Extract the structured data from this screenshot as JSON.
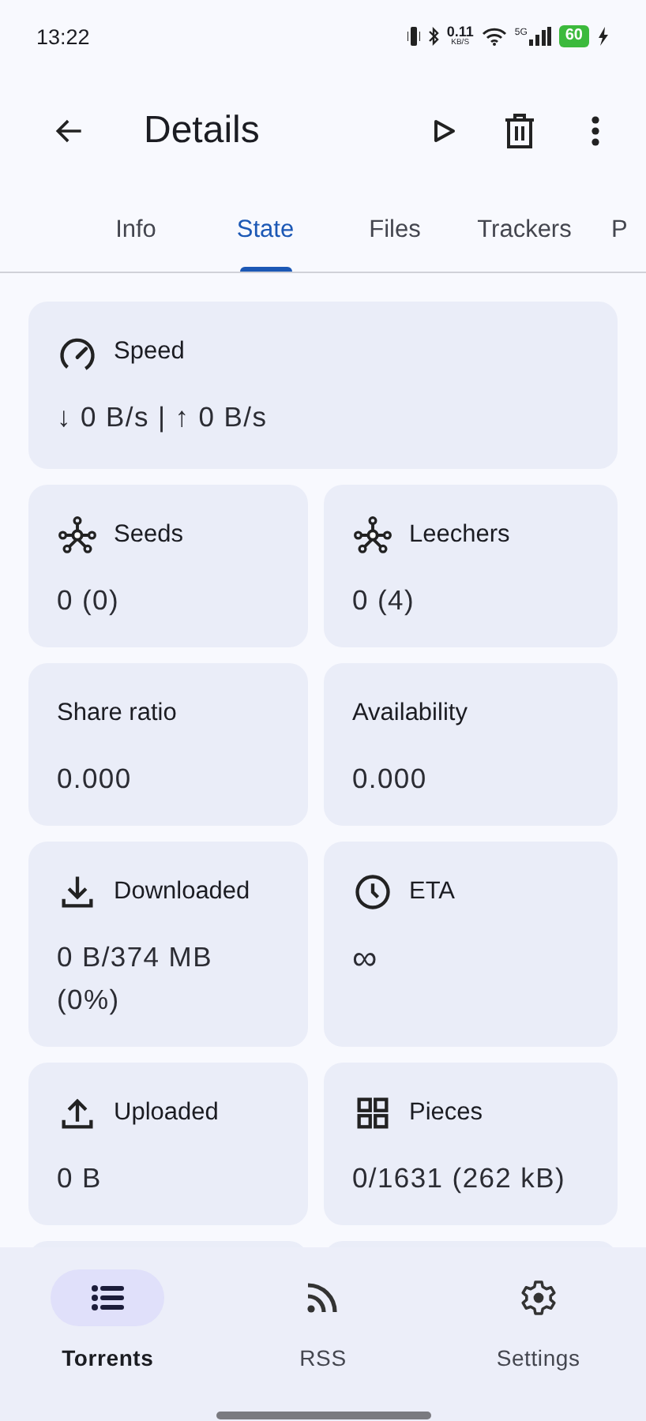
{
  "status_bar": {
    "time": "13:22",
    "net_speed": "0.11",
    "net_unit": "KB/S",
    "network": "5G",
    "battery": "60",
    "charging": true
  },
  "app_bar": {
    "title": "Details"
  },
  "tabs": [
    {
      "label": "Info",
      "selected": false
    },
    {
      "label": "State",
      "selected": true
    },
    {
      "label": "Files",
      "selected": false
    },
    {
      "label": "Trackers",
      "selected": false
    },
    {
      "label": "P",
      "selected": false
    }
  ],
  "cards": [
    {
      "title": "Speed",
      "value": "↓ 0 B/s | ↑ 0 B/s",
      "wide": true
    },
    {
      "title": "Seeds",
      "value": "0 (0)",
      "wide": false
    },
    {
      "title": "Leechers",
      "value": "0 (4)",
      "wide": false
    },
    {
      "title": "Share ratio",
      "value": "0.000",
      "wide": false
    },
    {
      "title": "Availability",
      "value": "0.000",
      "wide": false
    },
    {
      "title": "Downloaded",
      "value": "0 B/374 MB (0%)",
      "wide": false
    },
    {
      "title": "ETA",
      "value": "∞",
      "wide": false
    },
    {
      "title": "Uploaded",
      "value": "0 B",
      "wide": false
    },
    {
      "title": "Pieces",
      "value": "0/1631 (262 kB)",
      "wide": false
    }
  ],
  "bottom_nav": [
    {
      "label": "Torrents",
      "selected": true
    },
    {
      "label": "RSS",
      "selected": false
    },
    {
      "label": "Settings",
      "selected": false
    }
  ]
}
